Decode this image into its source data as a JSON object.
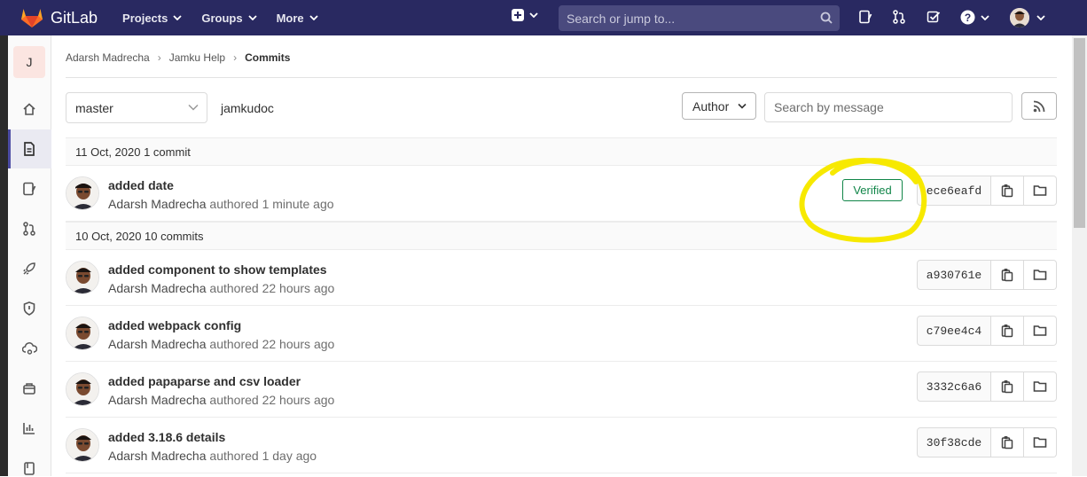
{
  "topnav": {
    "brand": "GitLab",
    "menu": [
      {
        "label": "Projects"
      },
      {
        "label": "Groups"
      },
      {
        "label": "More"
      }
    ],
    "search_placeholder": "Search or jump to..."
  },
  "sidebar": {
    "project_initial": "J"
  },
  "breadcrumb": {
    "items": [
      "Adarsh Madrecha",
      "Jamku Help",
      "Commits"
    ]
  },
  "filters": {
    "branch": "master",
    "path": "jamkudoc",
    "author_label": "Author",
    "search_placeholder": "Search by message"
  },
  "days": [
    {
      "header": "11 Oct, 2020 1 commit",
      "commits": [
        {
          "title": "added date",
          "author": "Adarsh Madrecha",
          "authored": "authored",
          "time": "1 minute ago",
          "sha": "ece6eafd",
          "verified": "Verified"
        }
      ]
    },
    {
      "header": "10 Oct, 2020 10 commits",
      "commits": [
        {
          "title": "added component to show templates",
          "author": "Adarsh Madrecha",
          "authored": "authored",
          "time": "22 hours ago",
          "sha": "a930761e"
        },
        {
          "title": "added webpack config",
          "author": "Adarsh Madrecha",
          "authored": "authored",
          "time": "22 hours ago",
          "sha": "c79ee4c4"
        },
        {
          "title": "added papaparse and csv loader",
          "author": "Adarsh Madrecha",
          "authored": "authored",
          "time": "22 hours ago",
          "sha": "3332c6a6"
        },
        {
          "title": "added 3.18.6 details",
          "author": "Adarsh Madrecha",
          "authored": "authored",
          "time": "1 day ago",
          "sha": "30f38cde"
        }
      ]
    }
  ],
  "colors": {
    "nav_bg": "#292961",
    "verified_green": "#108548",
    "highlight_yellow": "#f7e900"
  }
}
